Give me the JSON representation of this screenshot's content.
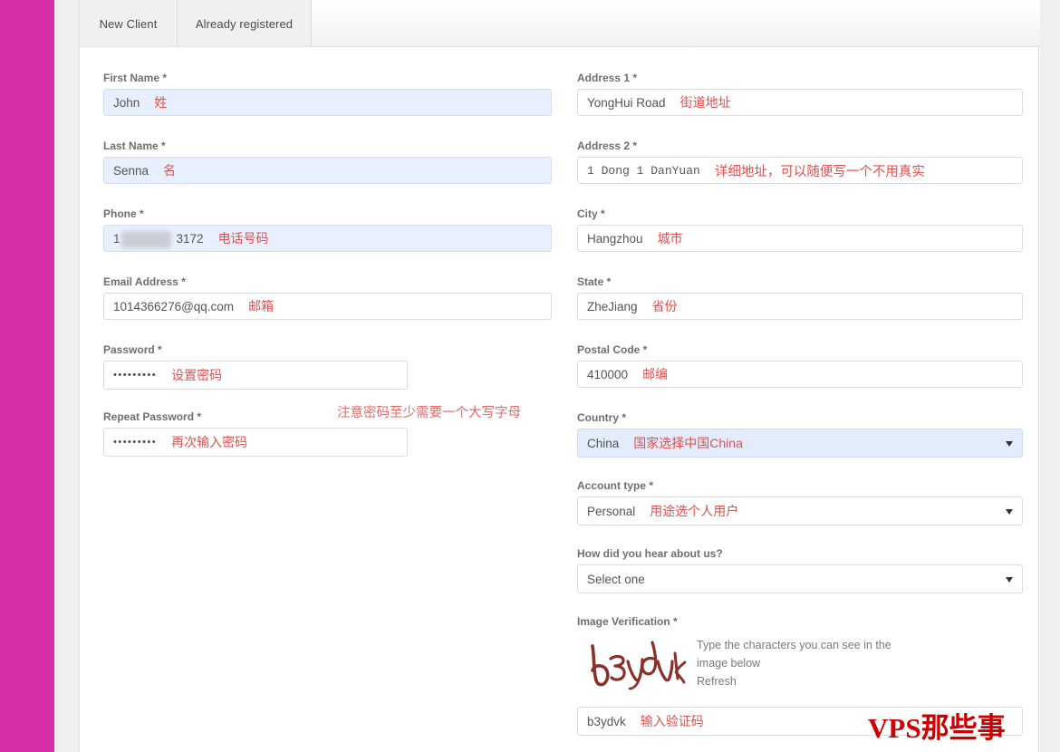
{
  "tabs": [
    {
      "label": "New Client",
      "active": true
    },
    {
      "label": "Already registered",
      "active": false
    }
  ],
  "colors": {
    "edge_bar": "#d82fa8",
    "annotation_red": "#e05050",
    "watermark_red": "#cc0000",
    "autofill_blue": "#e8f0fe",
    "captcha_ink": "#8b2f2a"
  },
  "left_column": {
    "first_name": {
      "label": "First Name *",
      "value": "John",
      "note": "姓"
    },
    "last_name": {
      "label": "Last Name *",
      "value": "Senna",
      "note": "名"
    },
    "phone": {
      "label": "Phone *",
      "value_prefix": "1",
      "value_suffix": "3172",
      "redacted": true,
      "note": "电话号码"
    },
    "email": {
      "label": "Email Address *",
      "value": "1014366276@qq.com",
      "note": "邮箱"
    },
    "password": {
      "label": "Password *",
      "value": "•••••••••",
      "note": "设置密码"
    },
    "password_hint": "注意密码至少需要一个大写字母",
    "repeat_password": {
      "label": "Repeat Password *",
      "value": "•••••••••",
      "note": "再次输入密码"
    }
  },
  "right_column": {
    "address1": {
      "label": "Address 1 *",
      "value": "YongHui Road",
      "note": "街道地址"
    },
    "address2": {
      "label": "Address 2 *",
      "value": "1 Dong 1 DanYuan",
      "note": "详细地址，可以随便写一个不用真实"
    },
    "city": {
      "label": "City *",
      "value": "Hangzhou",
      "note": "城市"
    },
    "state": {
      "label": "State *",
      "value": "ZheJiang",
      "note": "省份"
    },
    "postal_code": {
      "label": "Postal Code *",
      "value": "410000",
      "note": "邮编"
    },
    "country": {
      "label": "Country *",
      "value": "China",
      "note": "国家选择中国China"
    },
    "account_type": {
      "label": "Account type *",
      "value": "Personal",
      "note": "用途选个人用户"
    },
    "hear_about": {
      "label": "How did you hear about us?",
      "value": "Select one"
    },
    "image_verification": {
      "label": "Image Verification *",
      "captcha_text": "b3ydvk",
      "instruction_line1": "Type the characters you can see in the",
      "instruction_line2": "image below",
      "refresh_label": "Refresh",
      "input_value": "b3ydvk",
      "note": "输入验证码"
    }
  },
  "watermark": "VPS那些事"
}
